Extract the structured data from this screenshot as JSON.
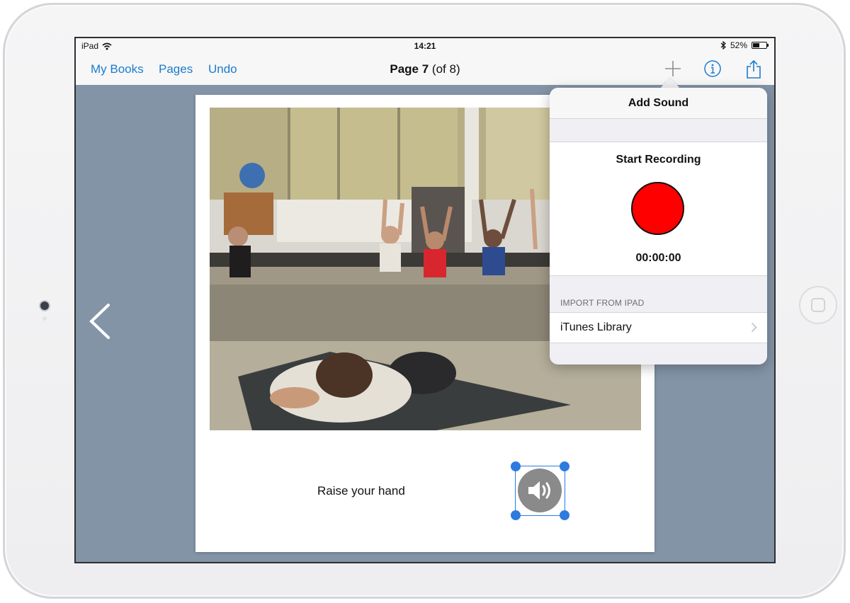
{
  "status_bar": {
    "device": "iPad",
    "time": "14:21",
    "battery": "52%",
    "battery_level": 0.52
  },
  "nav": {
    "my_books": "My Books",
    "pages": "Pages",
    "undo": "Undo",
    "title_main": "Page 7",
    "title_sub": "(of 8)",
    "icons": [
      "plus-icon",
      "info-icon",
      "share-icon"
    ]
  },
  "page": {
    "caption": "Raise your hand",
    "photo": "classroom-students-raising-hands",
    "sound_icon": "speaker-icon"
  },
  "popover": {
    "title": "Add Sound",
    "start_recording": "Start Recording",
    "timer": "00:00:00",
    "import_header": "IMPORT FROM IPAD",
    "itunes_library": "iTunes Library"
  },
  "colors": {
    "accent": "#1c7ccd",
    "canvas": "#8394a7",
    "record": "#ff0000",
    "selection": "#2e7be0"
  }
}
